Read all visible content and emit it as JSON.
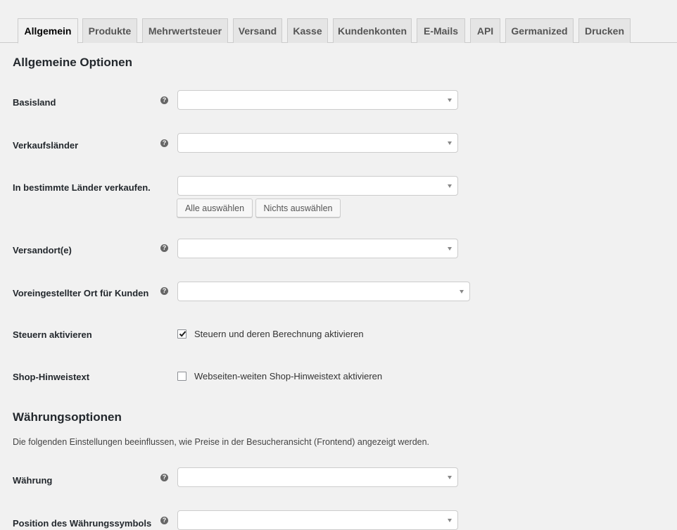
{
  "tabs": [
    {
      "label": "Allgemein",
      "active": true
    },
    {
      "label": "Produkte"
    },
    {
      "label": "Mehrwertsteuer"
    },
    {
      "label": "Versand"
    },
    {
      "label": "Kasse"
    },
    {
      "label": "Kundenkonten"
    },
    {
      "label": "E-Mails"
    },
    {
      "label": "API"
    },
    {
      "label": "Germanized"
    },
    {
      "label": "Drucken"
    }
  ],
  "general": {
    "heading": "Allgemeine Optionen",
    "fields": {
      "basisland": {
        "label": "Basisland",
        "value": ""
      },
      "verkaufslaender": {
        "label": "Verkaufsländer",
        "value": ""
      },
      "bestimmte_laender": {
        "label": "In bestimmte Länder verkaufen.",
        "value": ""
      },
      "versandort": {
        "label": "Versandort(e)",
        "value": ""
      },
      "standard_ort": {
        "label": "Voreingestellter Ort für Kunden",
        "value": ""
      },
      "steuern": {
        "label": "Steuern aktivieren",
        "checkbox_label": "Steuern und deren Berechnung aktivieren",
        "checked": true
      },
      "shop_hinweis": {
        "label": "Shop-Hinweistext",
        "checkbox_label": "Webseiten-weiten Shop-Hinweistext aktivieren",
        "checked": false
      }
    },
    "buttons": {
      "select_all": "Alle auswählen",
      "select_none": "Nichts auswählen"
    }
  },
  "currency": {
    "heading": "Währungsoptionen",
    "description": "Die folgenden Einstellungen beeinflussen, wie Preise in der Besucheransicht (Frontend) angezeigt werden.",
    "fields": {
      "waehrung": {
        "label": "Währung",
        "value": ""
      },
      "position": {
        "label": "Position des Währungssymbols",
        "value": ""
      }
    }
  },
  "icons": {
    "help": "question-mark-help-icon",
    "dropdown": "chevron-down-icon",
    "check": "check-icon"
  },
  "colors": {
    "background": "#f1f1f1",
    "tab_inactive": "#e5e5e5",
    "border": "#cccccc",
    "text": "#23282d"
  }
}
